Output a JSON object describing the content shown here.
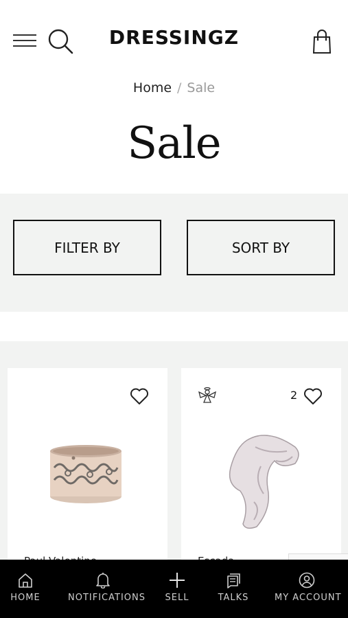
{
  "header": {
    "logo": "DRESSINGZ",
    "icons": [
      "menu-icon",
      "search-icon",
      "shopping-bag-icon"
    ]
  },
  "breadcrumb": {
    "home": "Home",
    "separator": "/",
    "current": "Sale"
  },
  "page_title": "Sale",
  "filters": {
    "filter_label": "FILTER BY",
    "sort_label": "SORT BY"
  },
  "products": [
    {
      "name": "Paul Valentine",
      "likes": "",
      "badge_icon": "",
      "icon": "heart-icon"
    },
    {
      "name": "Escada",
      "likes": "2",
      "badge_icon": "angel-icon",
      "icon": "heart-icon"
    }
  ],
  "bottom_nav": [
    {
      "label": "HOME",
      "icon": "home-icon"
    },
    {
      "label": "NOTIFICATIONS",
      "icon": "bell-icon"
    },
    {
      "label": "SELL",
      "icon": "plus-icon"
    },
    {
      "label": "TALKS",
      "icon": "chat-icon"
    },
    {
      "label": "MY ACCOUNT",
      "icon": "account-icon"
    }
  ],
  "colors": {
    "background": "#ffffff",
    "band": "#f2f3f2",
    "text": "#111111",
    "nav_background": "#000000",
    "nav_text": "#cfcfcf"
  }
}
